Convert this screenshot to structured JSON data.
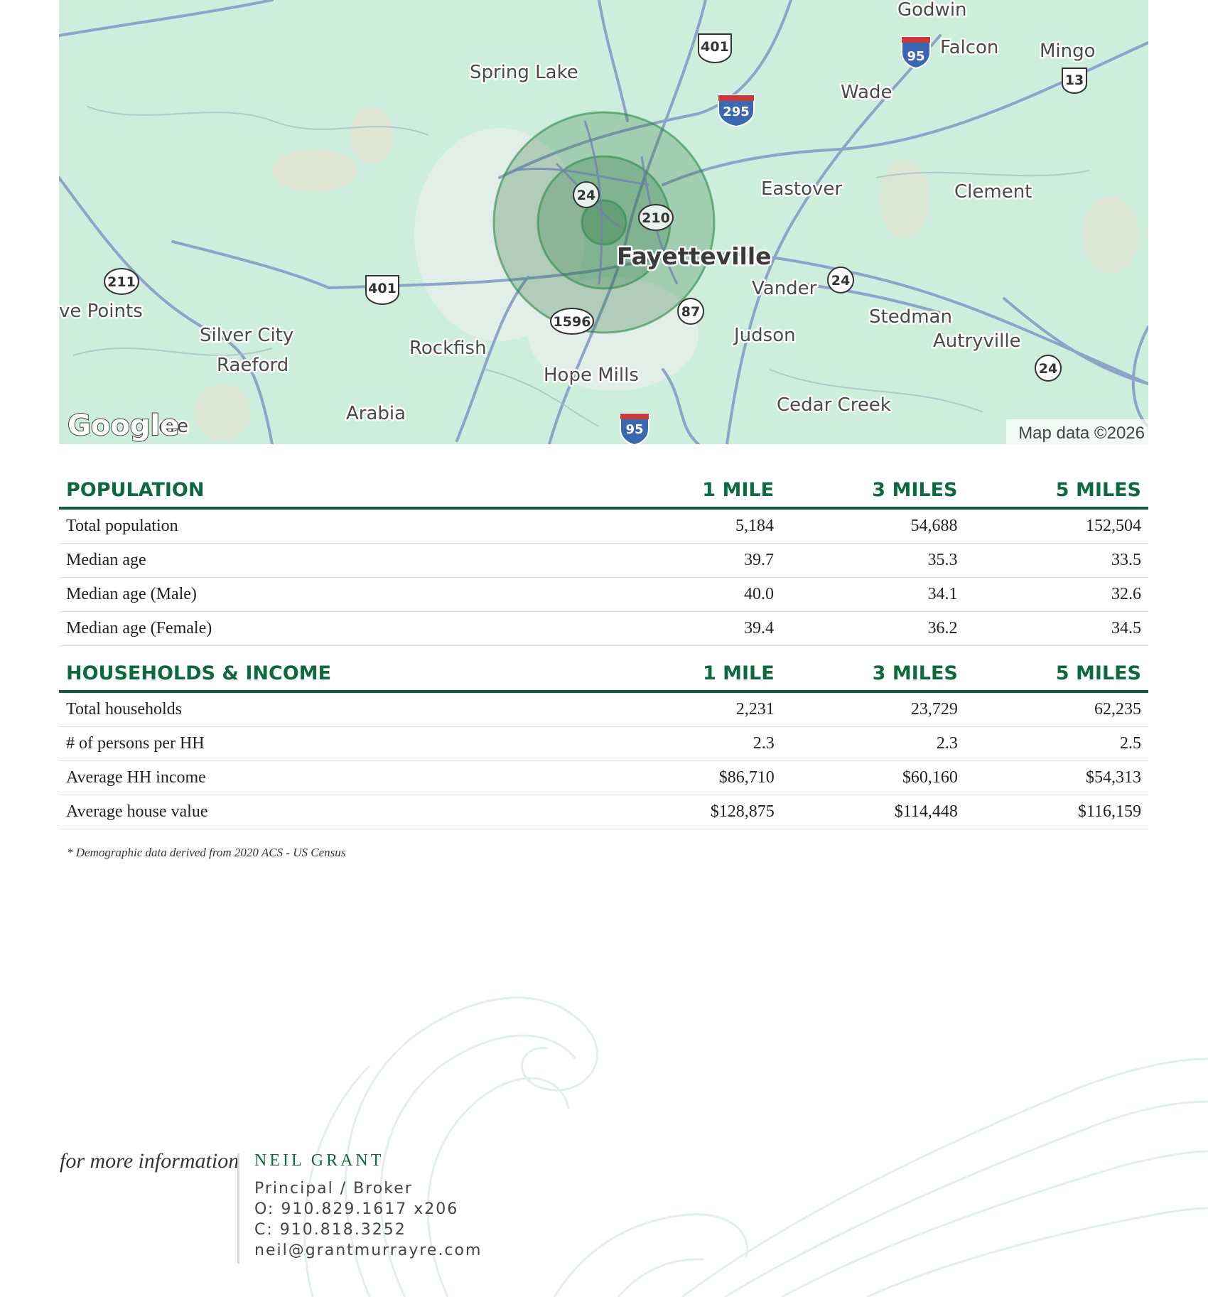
{
  "map": {
    "labels": {
      "godwin": "Godwin",
      "falcon": "Falcon",
      "mingo": "Mingo",
      "spring_lake": "Spring Lake",
      "wade": "Wade",
      "eastover": "Eastover",
      "clement": "Clement",
      "fayetteville": "Fayetteville",
      "vander": "Vander",
      "stedman": "Stedman",
      "autryville": "Autryville",
      "judson": "Judson",
      "seven_points": "ve Points",
      "silver_city": "Silver City",
      "raeford": "Raeford",
      "rockfish": "Rockfish",
      "hope_mills": "Hope Mills",
      "cedar_creek": "Cedar Creek",
      "arabia": "Arabia",
      "more_fragment": "ore"
    },
    "shields": {
      "us401_top": "401",
      "us401_left": "401",
      "i95_top": "95",
      "i95_bottom": "95",
      "nc13": "13",
      "i295": "295",
      "nc24_center": "24",
      "nc210": "210",
      "nc211": "211",
      "nc24_east": "24",
      "nc24_far": "24",
      "nc87": "87",
      "sr1596": "1596"
    },
    "google_logo": "Google",
    "attribution": "Map data ©2026",
    "colors": {
      "land": "#cdeedd",
      "road": "#8ea3c7",
      "radius_fill": "#1f6b2f"
    }
  },
  "population": {
    "headers": [
      "POPULATION",
      "1 MILE",
      "3 MILES",
      "5 MILES"
    ],
    "rows": [
      [
        "Total population",
        "5,184",
        "54,688",
        "152,504"
      ],
      [
        "Median age",
        "39.7",
        "35.3",
        "33.5"
      ],
      [
        "Median age (Male)",
        "40.0",
        "34.1",
        "32.6"
      ],
      [
        "Median age (Female)",
        "39.4",
        "36.2",
        "34.5"
      ]
    ]
  },
  "households": {
    "headers": [
      "HOUSEHOLDS & INCOME",
      "1 MILE",
      "3 MILES",
      "5 MILES"
    ],
    "rows": [
      [
        "Total households",
        "2,231",
        "23,729",
        "62,235"
      ],
      [
        "# of persons per HH",
        "2.3",
        "2.3",
        "2.5"
      ],
      [
        "Average HH income",
        "$86,710",
        "$60,160",
        "$54,313"
      ],
      [
        "Average house value",
        "$128,875",
        "$114,448",
        "$116,159"
      ]
    ]
  },
  "footnote": "* Demographic data derived from 2020 ACS - US Census",
  "contact": {
    "lead": "for more information",
    "name": "NEIL GRANT",
    "title": "Principal / Broker",
    "office": "O: 910.829.1617 x206",
    "cell": "C: 910.818.3252",
    "email": "neil@grantmurrayre.com"
  },
  "colors": {
    "accent": "#0c6a3c",
    "rule": "#0c5e36"
  }
}
